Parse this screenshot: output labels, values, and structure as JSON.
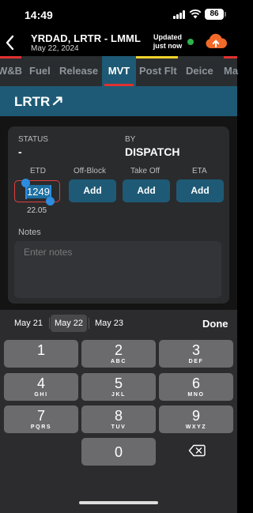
{
  "status_bar": {
    "time": "14:49",
    "battery": "86"
  },
  "header": {
    "title": "YRDAD, LRTR - LMML",
    "date": "May 22, 2024",
    "updated_line1": "Updated",
    "updated_line2": "just now"
  },
  "tabs": [
    "W&B",
    "Fuel",
    "Release",
    "MVT",
    "Post Flt",
    "Deice",
    "Ma"
  ],
  "active_tab": "MVT",
  "route": {
    "code": "LRTR"
  },
  "movement": {
    "status_label": "STATUS",
    "status_value": "-",
    "by_label": "BY",
    "by_value": "DISPATCH",
    "etd_label": "ETD",
    "etd_value": "1249",
    "etd_date": "22.05",
    "offblock_label": "Off-Block",
    "takeoff_label": "Take Off",
    "eta_label": "ETA",
    "add_label": "Add",
    "notes_label": "Notes",
    "notes_placeholder": "Enter notes"
  },
  "keyboard": {
    "dates": [
      "May 21",
      "May 22",
      "May 23"
    ],
    "selected_date": "May 22",
    "done_label": "Done",
    "keys": [
      {
        "digit": "1",
        "letters": ""
      },
      {
        "digit": "2",
        "letters": "ABC"
      },
      {
        "digit": "3",
        "letters": "DEF"
      },
      {
        "digit": "4",
        "letters": "GHI"
      },
      {
        "digit": "5",
        "letters": "JKL"
      },
      {
        "digit": "6",
        "letters": "MNO"
      },
      {
        "digit": "7",
        "letters": "PQRS"
      },
      {
        "digit": "8",
        "letters": "TUV"
      },
      {
        "digit": "9",
        "letters": "WXYZ"
      },
      {
        "digit": "0",
        "letters": ""
      }
    ]
  },
  "colors": {
    "accent_blue": "#1e5a75",
    "alert_red": "#e03131",
    "status_green": "#2fb24b",
    "cloud_orange": "#f26a2a",
    "warning_yellow": "#f2d22a"
  }
}
